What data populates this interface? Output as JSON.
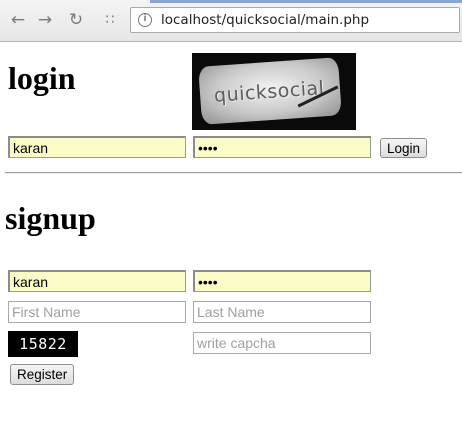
{
  "browser": {
    "url": "localhost/quicksocial/main.php"
  },
  "login": {
    "heading": "login",
    "logo_text": "quicksocial",
    "username_value": "karan",
    "password_value": "abcd",
    "button_label": "Login"
  },
  "signup": {
    "heading": "signup",
    "username_value": "karan",
    "password_value": "abcd",
    "first_name_placeholder": "First Name",
    "last_name_placeholder": "Last Name",
    "captcha_text": "15822",
    "captcha_placeholder": "write capcha",
    "button_label": "Register"
  }
}
